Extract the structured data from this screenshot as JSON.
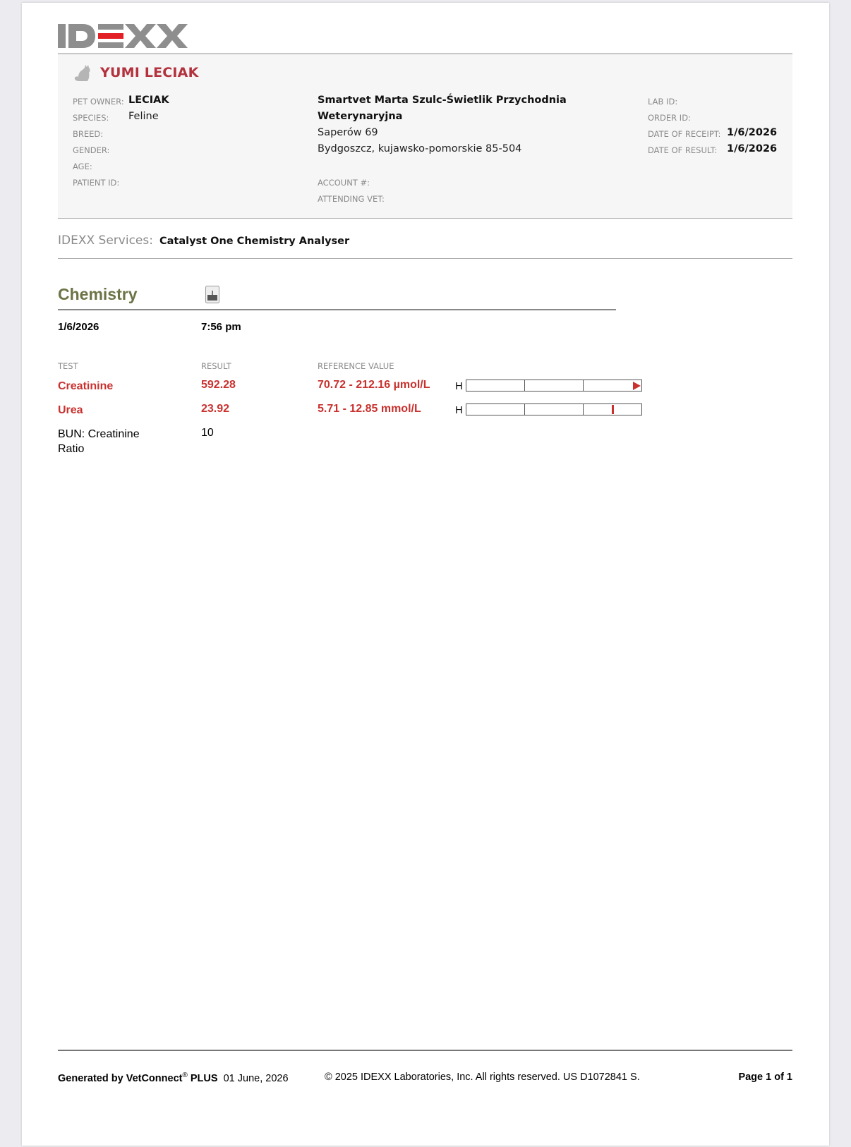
{
  "brand": {
    "name": "IDEXX",
    "accent": "#e31f26",
    "gray": "#8e8e8e"
  },
  "patient": {
    "name": "YUMI LECIAK",
    "pet_owner_label": "PET OWNER:",
    "pet_owner": "LECIAK",
    "species_label": "SPECIES:",
    "species": "Feline",
    "breed_label": "BREED:",
    "gender_label": "GENDER:",
    "age_label": "AGE:",
    "patient_id_label": "PATIENT ID:"
  },
  "clinic": {
    "name_line1": "Smartvet Marta Szulc-Świetlik Przychodnia",
    "name_line2": "Weterynaryjna",
    "street": "Saperów 69",
    "city": "Bydgoszcz, kujawsko-pomorskie 85-504",
    "account_label": "ACCOUNT #:",
    "attending_vet_label": "ATTENDING VET:"
  },
  "order": {
    "lab_id_label": "LAB ID:",
    "order_id_label": "ORDER ID:",
    "receipt_label": "DATE OF RECEIPT:",
    "receipt_date": "1/6/2026",
    "result_label": "DATE OF RESULT:",
    "result_date": "1/6/2026"
  },
  "services": {
    "label": "IDEXX Services:",
    "value": "Catalyst One Chemistry Analyser"
  },
  "chemistry": {
    "title": "Chemistry",
    "date": "1/6/2026",
    "time": "7:56 pm",
    "headers": {
      "test": "TEST",
      "result": "RESULT",
      "reference": "REFERENCE VALUE"
    },
    "rows": [
      {
        "test": "Creatinine",
        "result": "592.28",
        "reference": "70.72 - 212.16 µmol/L",
        "flag": "H",
        "abnormal": true,
        "marker": "arrow"
      },
      {
        "test": "Urea",
        "result": "23.92",
        "reference": "5.71 - 12.85 mmol/L",
        "flag": "H",
        "abnormal": true,
        "marker_fraction": 0.83
      },
      {
        "test": "BUN: Creatinine Ratio",
        "result": "10",
        "reference": "",
        "flag": "",
        "abnormal": false
      }
    ]
  },
  "footer": {
    "generated_prefix": "Generated by VetConnect",
    "registered": "®",
    "plus": "PLUS",
    "generated_date": "01 June, 2026",
    "copyright": "© 2025 IDEXX Laboratories, Inc. All rights reserved. US D1072841 S.",
    "page": "Page 1 of 1"
  }
}
